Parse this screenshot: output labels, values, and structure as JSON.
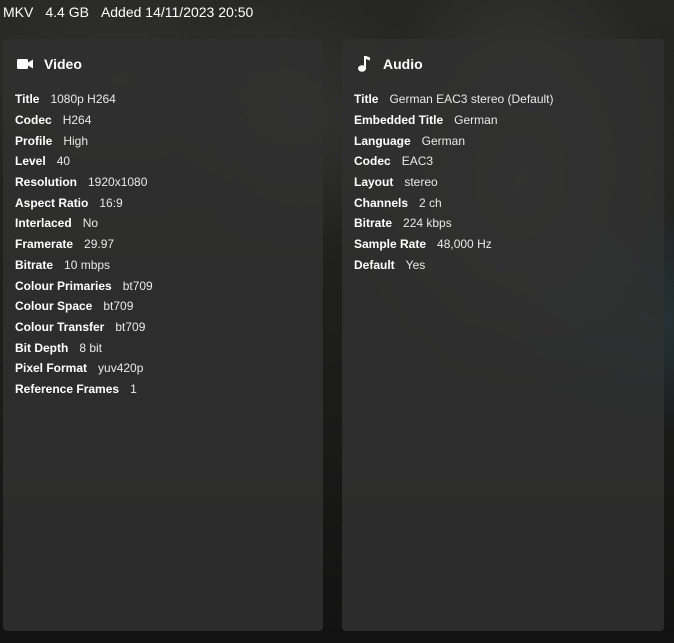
{
  "topbar": {
    "container": "MKV",
    "size": "4.4 GB",
    "added": "Added 14/11/2023 20:50"
  },
  "video": {
    "icon": "videocam-icon",
    "title": "Video",
    "rows": [
      {
        "label": "Title",
        "value": "1080p H264"
      },
      {
        "label": "Codec",
        "value": "H264"
      },
      {
        "label": "Profile",
        "value": "High"
      },
      {
        "label": "Level",
        "value": "40"
      },
      {
        "label": "Resolution",
        "value": "1920x1080"
      },
      {
        "label": "Aspect Ratio",
        "value": "16:9"
      },
      {
        "label": "Interlaced",
        "value": "No"
      },
      {
        "label": "Framerate",
        "value": "29.97"
      },
      {
        "label": "Bitrate",
        "value": "10 mbps"
      },
      {
        "label": "Colour Primaries",
        "value": "bt709"
      },
      {
        "label": "Colour Space",
        "value": "bt709"
      },
      {
        "label": "Colour Transfer",
        "value": "bt709"
      },
      {
        "label": "Bit Depth",
        "value": "8 bit"
      },
      {
        "label": "Pixel Format",
        "value": "yuv420p"
      },
      {
        "label": "Reference Frames",
        "value": "1"
      }
    ]
  },
  "audio": {
    "icon": "music-note-icon",
    "title": "Audio",
    "rows": [
      {
        "label": "Title",
        "value": "German EAC3 stereo (Default)"
      },
      {
        "label": "Embedded Title",
        "value": "German"
      },
      {
        "label": "Language",
        "value": "German"
      },
      {
        "label": "Codec",
        "value": "EAC3"
      },
      {
        "label": "Layout",
        "value": "stereo"
      },
      {
        "label": "Channels",
        "value": "2 ch"
      },
      {
        "label": "Bitrate",
        "value": "224 kbps"
      },
      {
        "label": "Sample Rate",
        "value": "48,000 Hz"
      },
      {
        "label": "Default",
        "value": "Yes"
      }
    ]
  }
}
